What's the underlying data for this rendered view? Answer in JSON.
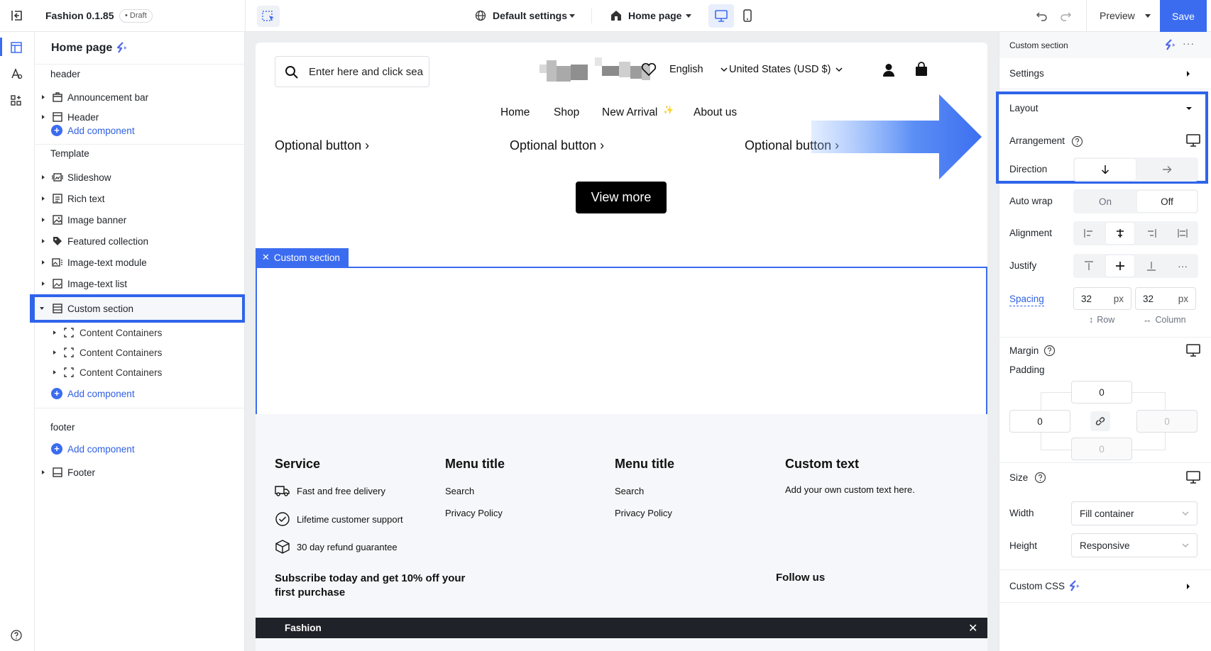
{
  "topbar": {
    "app_title": "Fashion 0.1.85",
    "draft_badge": "• Draft",
    "settings_label": "Default settings",
    "page_label": "Home page",
    "preview_label": "Preview",
    "save_label": "Save"
  },
  "layers": {
    "title": "Home page",
    "header_group": "header",
    "header_items": [
      "Announcement bar",
      "Header"
    ],
    "add_component": "Add component",
    "template_group": "Template",
    "template_items": [
      "Slideshow",
      "Rich text",
      "Image banner",
      "Featured collection",
      "Image-text module",
      "Image-text list",
      "Custom section"
    ],
    "custom_children": [
      "Content Containers",
      "Content Containers",
      "Content Containers"
    ],
    "footer_group": "footer",
    "footer_items": [
      "Footer"
    ]
  },
  "store": {
    "search_placeholder": "Enter here and click sea",
    "language": "English",
    "currency": "United States (USD $)",
    "nav": [
      "Home",
      "Shop",
      "New Arrival",
      "About us"
    ],
    "nav_spark": "✨",
    "optional_buttons": [
      "Optional button ›",
      "Optional button ›",
      "Optional button ›"
    ],
    "view_more": "View more",
    "custom_section_tag": "Custom section",
    "footer": {
      "col1_title": "Service",
      "col1_items": [
        "Fast and free delivery",
        "Lifetime customer support",
        "30 day refund guarantee"
      ],
      "col2_title": "Menu title",
      "col2_items": [
        "Search",
        "Privacy Policy"
      ],
      "col3_title": "Menu title",
      "col3_items": [
        "Search",
        "Privacy Policy"
      ],
      "col4_title": "Custom text",
      "col4_text": "Add your own custom text here.",
      "subscribe": "Subscribe today and get 10% off your first purchase",
      "follow": "Follow us",
      "bar_label": "Fashion"
    }
  },
  "panel": {
    "title": "Custom section",
    "settings": "Settings",
    "layout": "Layout",
    "arrangement": "Arrangement",
    "direction": "Direction",
    "auto_wrap": "Auto wrap",
    "wrap_on": "On",
    "wrap_off": "Off",
    "alignment": "Alignment",
    "justify": "Justify",
    "spacing": "Spacing",
    "row_value": "32",
    "col_value": "32",
    "unit": "px",
    "row_label": "Row",
    "col_label": "Column",
    "margin": "Margin",
    "padding": "Padding",
    "pad_top": "0",
    "pad_left": "0",
    "pad_right": "0",
    "pad_bottom": "0",
    "size": "Size",
    "width": "Width",
    "width_value": "Fill container",
    "height": "Height",
    "height_value": "Responsive",
    "custom_css": "Custom CSS"
  },
  "colors": {
    "accent": "#3b6cf0",
    "highlight": "#2f64ea"
  }
}
